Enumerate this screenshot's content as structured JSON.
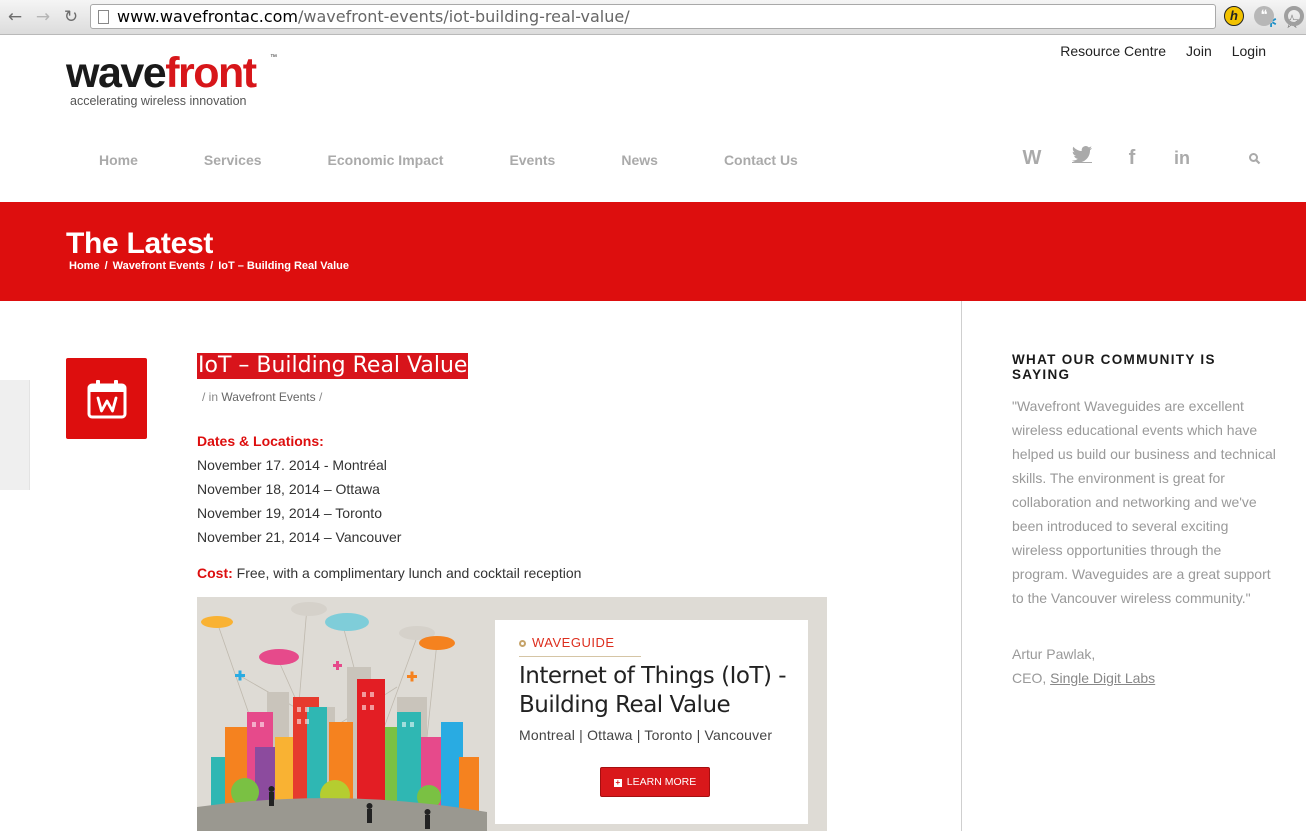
{
  "browser": {
    "url_host": "www.wavefrontac.com",
    "url_path": "/wavefront-events/iot-building-real-value/"
  },
  "header": {
    "logo_part1": "wave",
    "logo_part2": "front",
    "logo_tm": "™",
    "tagline": "accelerating wireless innovation",
    "top_links": [
      "Resource Centre",
      "Join",
      "Login"
    ],
    "nav": [
      "Home",
      "Services",
      "Economic Impact",
      "Events",
      "News",
      "Contact Us"
    ],
    "social": [
      "W",
      "twitter-icon",
      "facebook-icon",
      "linkedin-icon"
    ],
    "social_glyphs": {
      "w": "W",
      "tw": "🐦",
      "fb": "f",
      "ln": "in"
    }
  },
  "banner": {
    "title": "The Latest",
    "breadcrumb": [
      "Home",
      "/",
      "Wavefront Events",
      "/",
      "IoT – Building Real Value"
    ]
  },
  "post": {
    "title": "IoT – Building Real Value",
    "meta_prefix": "/ in ",
    "meta_category": "Wavefront Events",
    "meta_suffix": " /",
    "dates_label": "Dates & Locations:",
    "dates": [
      "November 17. 2014 - Montréal",
      "November 18, 2014 – Ottawa",
      "November 19, 2014 – Toronto",
      "November 21, 2014 – Vancouver"
    ],
    "cost_label": "Cost:",
    "cost_text": " Free, with a complimentary lunch and cocktail reception"
  },
  "promo": {
    "kicker": "WAVEGUIDE",
    "title_line1": "Internet of Things (IoT) -",
    "title_line2": "Building Real Value",
    "cities": "Montreal | Ottawa | Toronto | Vancouver",
    "button": "LEARN MORE",
    "button_plus": "+"
  },
  "sidebar": {
    "heading": "WHAT OUR COMMUNITY IS SAYING",
    "quote": "\"Wavefront Waveguides are excellent wireless educational events which have helped us build our business and technical skills. The environment is great for collaboration and networking and we've been introduced to several exciting wireless opportunities through the program.  Waveguides are a great support to the Vancouver wireless community.\"",
    "author": "Artur Pawlak,",
    "role_prefix": "CEO, ",
    "company": "Single Digit Labs"
  },
  "colors": {
    "brand_red": "#dd0e0e",
    "logo_red": "#d7161a",
    "nav_gray": "#aaaaaa"
  }
}
